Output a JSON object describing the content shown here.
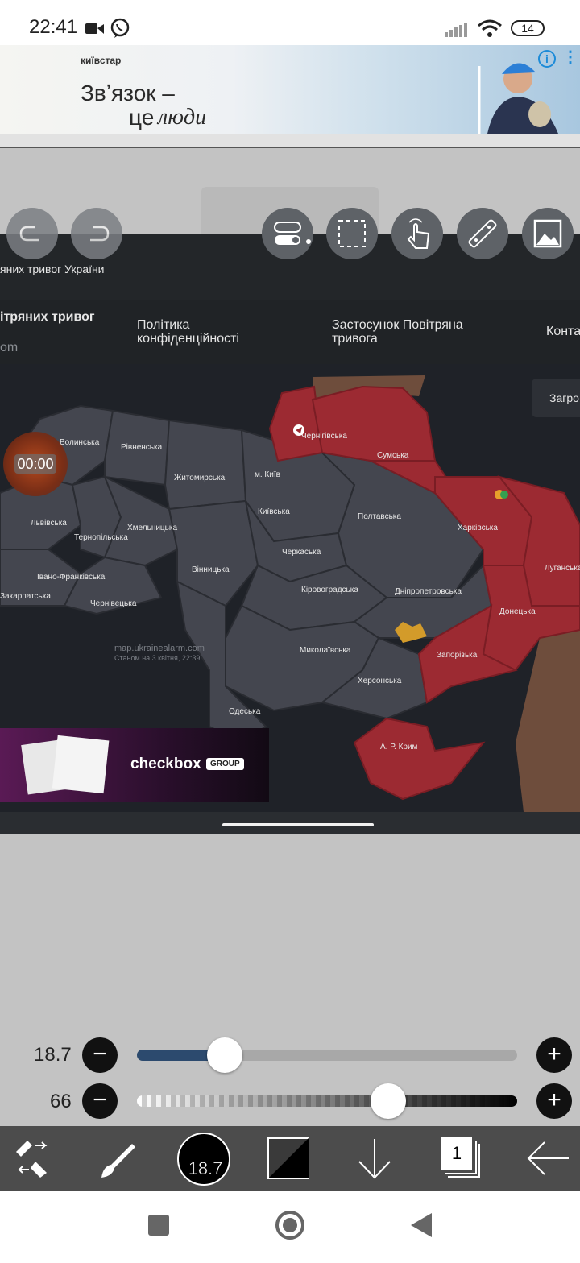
{
  "status_bar": {
    "time": "22:41",
    "battery": "14"
  },
  "ad_banner": {
    "brand": "київстар",
    "line1": "Звʼязок –",
    "line2_prefix": "це",
    "line2_italic": "люди"
  },
  "page_header": {
    "subtitle": "яних тривог України"
  },
  "nav": {
    "item1_line1": "ітряних тривог",
    "item1_line2": "om",
    "item2": "Політика конфіденційності",
    "item3": "Застосунок Повітряна тривога",
    "item4": "Конта"
  },
  "map": {
    "download_button": "Загро",
    "watermark_url": "map.ukrainealarm.com",
    "watermark_time": "Станом на 3 квітня, 22:39",
    "timer": "00:00",
    "regions": [
      "Волинська",
      "Рівненська",
      "Житомирська",
      "м. Київ",
      "Чернігівська",
      "Сумська",
      "Харківська",
      "Луганська",
      "Донецька",
      "Київська",
      "Полтавська",
      "Львівська",
      "Тернопільська",
      "Хмельницька",
      "Черкаська",
      "Вінницька",
      "Кіровоградська",
      "Дніпропетровська",
      "Івано-Франківська",
      "Закарпатська",
      "Чернівецька",
      "Запорізька",
      "Миколаївська",
      "Херсонська",
      "Одеська",
      "А. Р. Крим"
    ],
    "ad_brand": "checkbox",
    "ad_badge": "GROUP"
  },
  "sliders": [
    {
      "label": "18.7",
      "fill_fraction": 0.23,
      "minus": "−",
      "plus": "+"
    },
    {
      "label": "66",
      "fill_fraction": 0.66,
      "minus": "−",
      "plus": "+"
    }
  ],
  "bottom_tools": {
    "brush_size": "18.7",
    "layer_count": "1"
  },
  "colors": {
    "alarm_red": "#9c2a32",
    "region_gray": "#44464f",
    "slider_blue": "#2c4a6e",
    "bar_gray": "#4c4c4c"
  }
}
